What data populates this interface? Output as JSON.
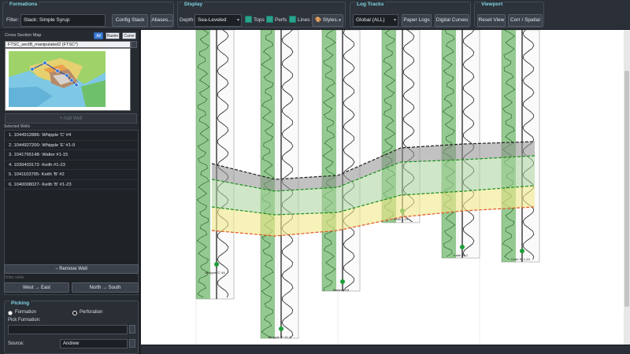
{
  "toolbar": {
    "formations": {
      "title": "Formations",
      "filter_label": "Filter:",
      "filter_value": "Stack: Simple Syrup",
      "config_stack": "Config Stack",
      "aliases": "Aliases..."
    },
    "display": {
      "title": "Display",
      "depth_label": "Depth:",
      "depth_value": "Sea-Leveled",
      "tops": "Tops",
      "perfs": "Perfs",
      "lines": "Lines",
      "styles": "Styles..."
    },
    "log_tracks": {
      "title": "Log Tracks",
      "scope_value": "Global (ALL)",
      "paper_logs": "Paper Logs",
      "digital_curves": "Digital Curves"
    },
    "viewport": {
      "title": "Viewport",
      "reset_view": "Reset View",
      "corr_spatial": "Corr / Spatial"
    }
  },
  "left_panel": {
    "cross_section_map": {
      "title": "Cross Section Map",
      "mode_options": [
        "All",
        "Raster",
        "Curve"
      ],
      "active_mode": "All",
      "map_layer": "FTSC_sectB_manipulated2 (FTSC*)"
    },
    "add_well": "+ Add Well",
    "selected_wells_label": "Selected Wells",
    "selected_wells": [
      "1. 1044912886- Whipple 'C' #4",
      "2. 1044927200- Whipple 'E' #1-9",
      "3. 1041765148- Walter #1-15",
      "4. 1039403172- Keith #1-23",
      "5. 1041103705- Keith 'B' #2",
      "6. 1040008027- Keith 'B' #1-23"
    ],
    "remove_well": "− Remove Well",
    "order_label": "Order wells",
    "west_east": "West → East",
    "north_south": "North → South",
    "picking": {
      "title": "Picking",
      "formation_label": "Formation",
      "perforation_label": "Perforation",
      "pick_formation_label": "Pick Formation:",
      "pick_formation_value": "",
      "source_label": "Source:",
      "source_value": "Andrew"
    }
  },
  "cross_section": {
    "colors": {
      "log_green": "#3fa13a",
      "top_band": "#8f8f8f",
      "mid_band": "#a8d39a",
      "low_band": "#f2ea8a",
      "top_line": "#222222",
      "mid_line": "#1e8e1e",
      "low_line": "#e0561f"
    },
    "well_labels": [
      "Whipple 'C' #4",
      "Whipple 'E' #1-9",
      "Walter 1-15",
      "Keith 1-23",
      "Keith 'B' 2",
      "Keith 'B' 1-23"
    ]
  }
}
